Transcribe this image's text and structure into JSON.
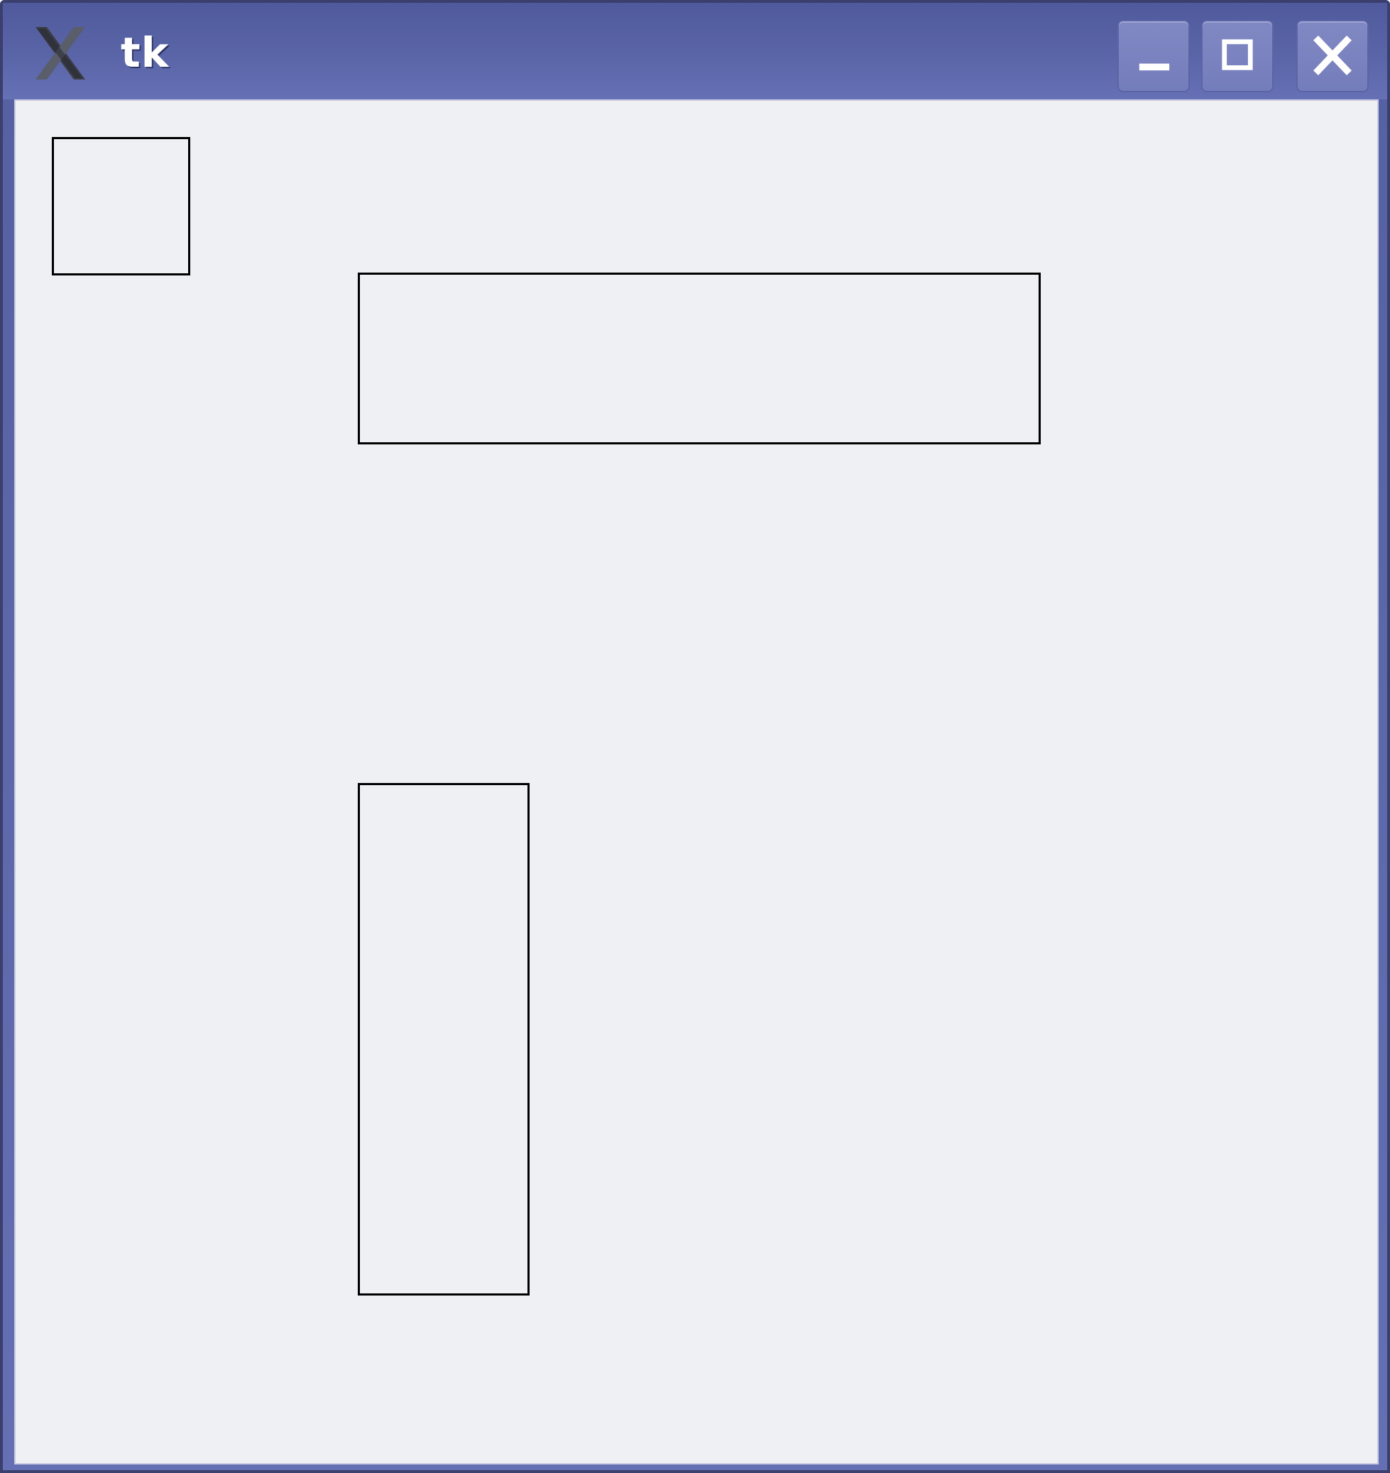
{
  "window": {
    "title": "tk",
    "app_icon": "x-logo-icon",
    "controls": {
      "minimize_icon": "minimize-icon",
      "maximize_icon": "maximize-icon",
      "close_icon": "close-icon"
    }
  },
  "colors": {
    "titlebar": "#5a65a8",
    "canvas_background": "#eff0f3",
    "shape_outline": "#000000"
  }
}
